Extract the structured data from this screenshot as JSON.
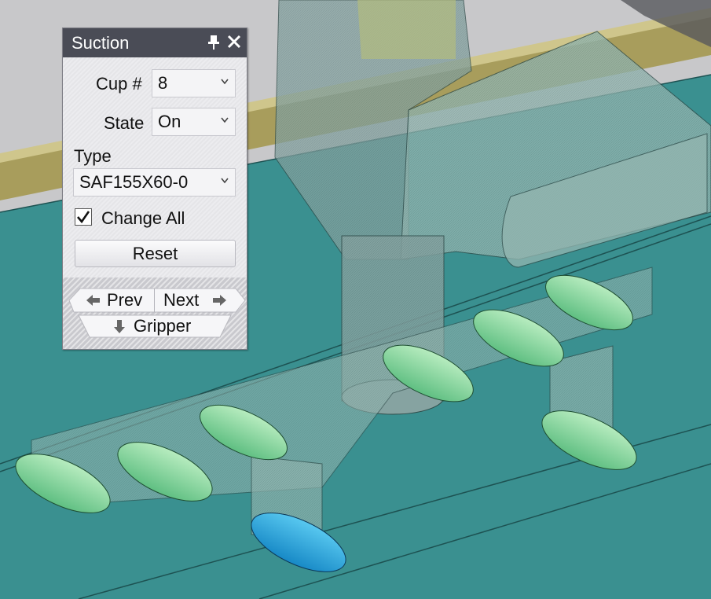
{
  "panel": {
    "title": "Suction",
    "pin_icon": "pin-icon",
    "close_icon": "close-icon",
    "cup_label": "Cup #",
    "cup_value": "8",
    "state_label": "State",
    "state_value": "On",
    "type_label": "Type",
    "type_value": "SAF155X60-0",
    "change_all_label": "Change All",
    "change_all_checked": true,
    "reset_label": "Reset",
    "prev_label": "Prev",
    "next_label": "Next",
    "gripper_label": "Gripper"
  },
  "scene": {
    "selected_cup_color": "#2aa3d8",
    "cup_color": "#8cd9a0",
    "floor_color": "#3a9090",
    "rail_color": "#a8a060"
  }
}
